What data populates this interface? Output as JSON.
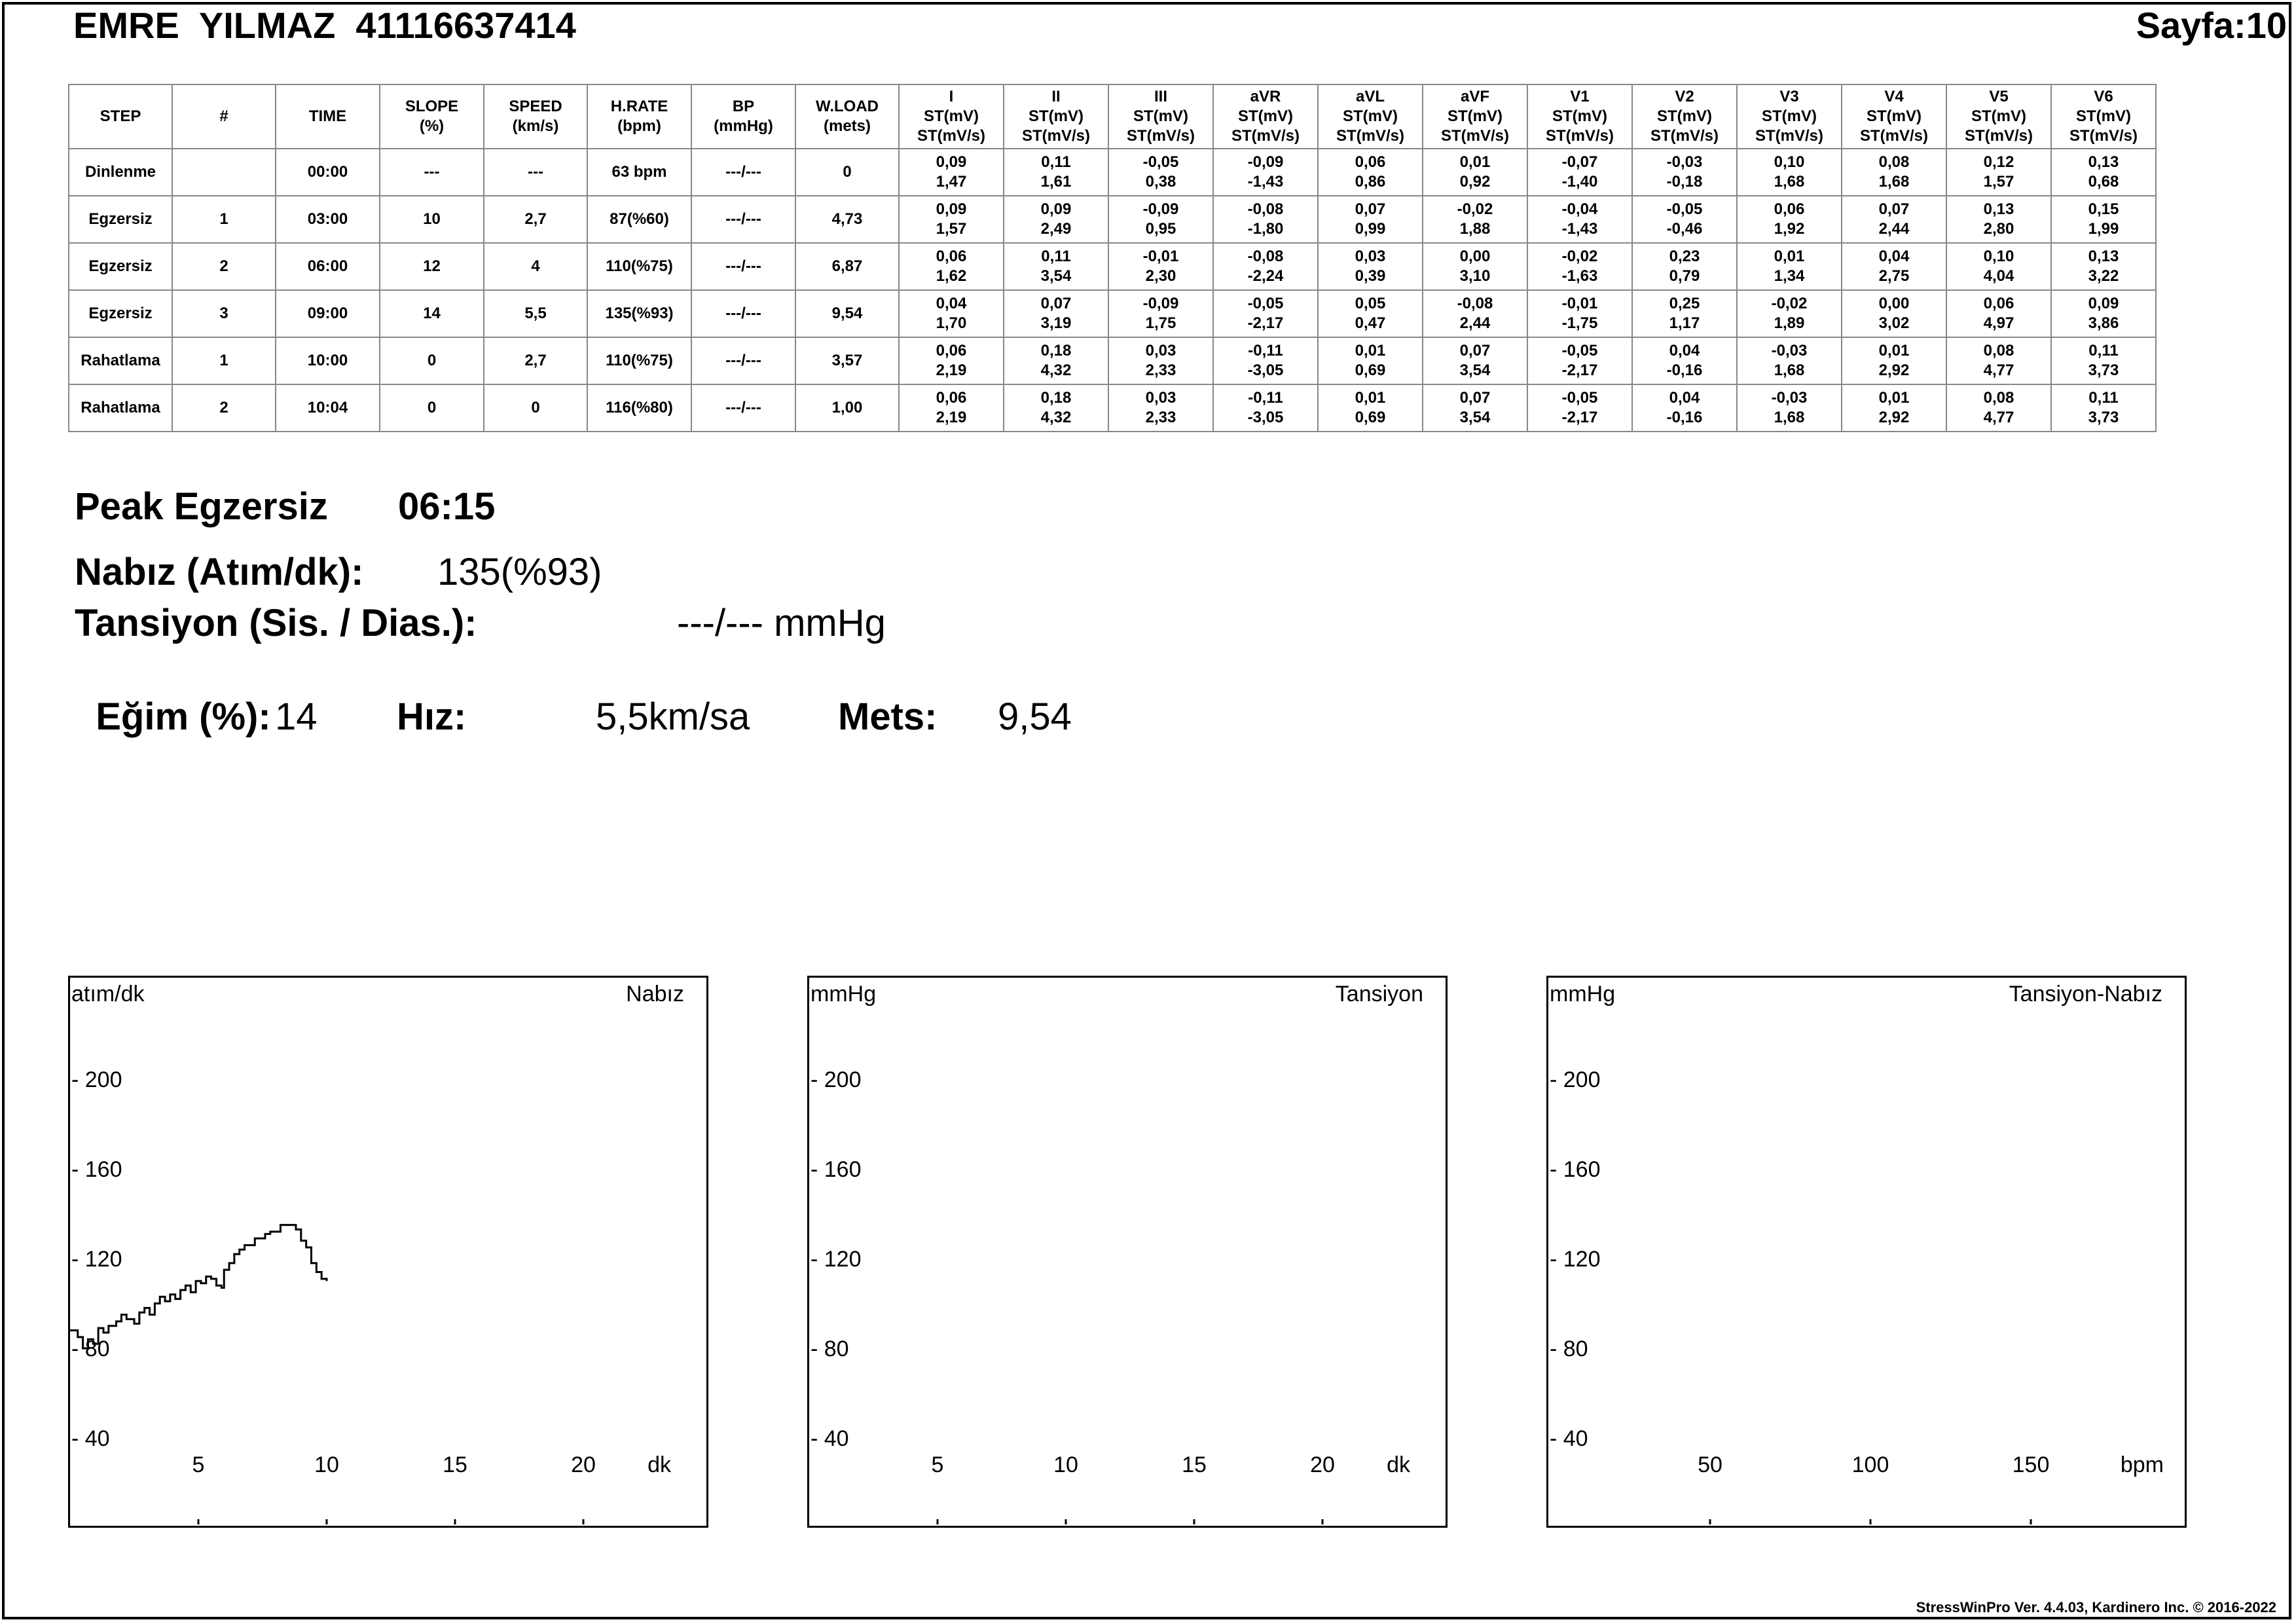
{
  "header": {
    "patient": "EMRE  YILMAZ  41116637414",
    "page": "Sayfa:10"
  },
  "table": {
    "headers": {
      "step": "STEP",
      "num": "#",
      "time": "TIME",
      "slope": [
        "SLOPE",
        "(%)"
      ],
      "speed": [
        "SPEED",
        "(km/s)"
      ],
      "hrate": [
        "H.RATE",
        "(bpm)"
      ],
      "bp": [
        "BP",
        "(mmHg)"
      ],
      "wload": [
        "W.LOAD",
        "(mets)"
      ],
      "st_sub": [
        "ST(mV)",
        "ST(mV/s)"
      ]
    },
    "leads": [
      "I",
      "II",
      "III",
      "aVR",
      "aVL",
      "aVF",
      "V1",
      "V2",
      "V3",
      "V4",
      "V5",
      "V6"
    ],
    "rows": [
      {
        "step": "Dinlenme",
        "num": "",
        "time": "00:00",
        "slope": "---",
        "speed": "---",
        "hrate": "63 bpm",
        "bp": "---/---",
        "wload": "0",
        "st": [
          [
            "0,09",
            "1,47"
          ],
          [
            "0,11",
            "1,61"
          ],
          [
            "-0,05",
            "0,38"
          ],
          [
            "-0,09",
            "-1,43"
          ],
          [
            "0,06",
            "0,86"
          ],
          [
            "0,01",
            "0,92"
          ],
          [
            "-0,07",
            "-1,40"
          ],
          [
            "-0,03",
            "-0,18"
          ],
          [
            "0,10",
            "1,68"
          ],
          [
            "0,08",
            "1,68"
          ],
          [
            "0,12",
            "1,57"
          ],
          [
            "0,13",
            "0,68"
          ]
        ]
      },
      {
        "step": "Egzersiz",
        "num": "1",
        "time": "03:00",
        "slope": "10",
        "speed": "2,7",
        "hrate": "87(%60)",
        "bp": "---/---",
        "wload": "4,73",
        "st": [
          [
            "0,09",
            "1,57"
          ],
          [
            "0,09",
            "2,49"
          ],
          [
            "-0,09",
            "0,95"
          ],
          [
            "-0,08",
            "-1,80"
          ],
          [
            "0,07",
            "0,99"
          ],
          [
            "-0,02",
            "1,88"
          ],
          [
            "-0,04",
            "-1,43"
          ],
          [
            "-0,05",
            "-0,46"
          ],
          [
            "0,06",
            "1,92"
          ],
          [
            "0,07",
            "2,44"
          ],
          [
            "0,13",
            "2,80"
          ],
          [
            "0,15",
            "1,99"
          ]
        ]
      },
      {
        "step": "Egzersiz",
        "num": "2",
        "time": "06:00",
        "slope": "12",
        "speed": "4",
        "hrate": "110(%75)",
        "bp": "---/---",
        "wload": "6,87",
        "st": [
          [
            "0,06",
            "1,62"
          ],
          [
            "0,11",
            "3,54"
          ],
          [
            "-0,01",
            "2,30"
          ],
          [
            "-0,08",
            "-2,24"
          ],
          [
            "0,03",
            "0,39"
          ],
          [
            "0,00",
            "3,10"
          ],
          [
            "-0,02",
            "-1,63"
          ],
          [
            "0,23",
            "0,79"
          ],
          [
            "0,01",
            "1,34"
          ],
          [
            "0,04",
            "2,75"
          ],
          [
            "0,10",
            "4,04"
          ],
          [
            "0,13",
            "3,22"
          ]
        ]
      },
      {
        "step": "Egzersiz",
        "num": "3",
        "time": "09:00",
        "slope": "14",
        "speed": "5,5",
        "hrate": "135(%93)",
        "bp": "---/---",
        "wload": "9,54",
        "st": [
          [
            "0,04",
            "1,70"
          ],
          [
            "0,07",
            "3,19"
          ],
          [
            "-0,09",
            "1,75"
          ],
          [
            "-0,05",
            "-2,17"
          ],
          [
            "0,05",
            "0,47"
          ],
          [
            "-0,08",
            "2,44"
          ],
          [
            "-0,01",
            "-1,75"
          ],
          [
            "0,25",
            "1,17"
          ],
          [
            "-0,02",
            "1,89"
          ],
          [
            "0,00",
            "3,02"
          ],
          [
            "0,06",
            "4,97"
          ],
          [
            "0,09",
            "3,86"
          ]
        ]
      },
      {
        "step": "Rahatlama",
        "num": "1",
        "time": "10:00",
        "slope": "0",
        "speed": "2,7",
        "hrate": "110(%75)",
        "bp": "---/---",
        "wload": "3,57",
        "st": [
          [
            "0,06",
            "2,19"
          ],
          [
            "0,18",
            "4,32"
          ],
          [
            "0,03",
            "2,33"
          ],
          [
            "-0,11",
            "-3,05"
          ],
          [
            "0,01",
            "0,69"
          ],
          [
            "0,07",
            "3,54"
          ],
          [
            "-0,05",
            "-2,17"
          ],
          [
            "0,04",
            "-0,16"
          ],
          [
            "-0,03",
            "1,68"
          ],
          [
            "0,01",
            "2,92"
          ],
          [
            "0,08",
            "4,77"
          ],
          [
            "0,11",
            "3,73"
          ]
        ]
      },
      {
        "step": "Rahatlama",
        "num": "2",
        "time": "10:04",
        "slope": "0",
        "speed": "0",
        "hrate": "116(%80)",
        "bp": "---/---",
        "wload": "1,00",
        "st": [
          [
            "0,06",
            "2,19"
          ],
          [
            "0,18",
            "4,32"
          ],
          [
            "0,03",
            "2,33"
          ],
          [
            "-0,11",
            "-3,05"
          ],
          [
            "0,01",
            "0,69"
          ],
          [
            "0,07",
            "3,54"
          ],
          [
            "-0,05",
            "-2,17"
          ],
          [
            "0,04",
            "-0,16"
          ],
          [
            "-0,03",
            "1,68"
          ],
          [
            "0,01",
            "2,92"
          ],
          [
            "0,08",
            "4,77"
          ],
          [
            "0,11",
            "3,73"
          ]
        ]
      }
    ]
  },
  "summary": {
    "peak_label": "Peak Egzersiz",
    "peak_time": "06:15",
    "pulse_label": "Nabız (Atım/dk):",
    "pulse_value": "135(%93)",
    "bp_label": "Tansiyon (Sis. / Dias.):",
    "bp_value": "---/--- mmHg",
    "slope_label": "Eğim (%):",
    "slope_value": "14",
    "speed_label": "Hız:",
    "speed_value": "5,5km/sa",
    "mets_label": "Mets:",
    "mets_value": "9,54"
  },
  "footer": "StressWinPro Ver. 4.4.03,  Kardinero Inc. © 2016-2022",
  "chart_data": [
    {
      "type": "line",
      "title": "Nabız",
      "ylabel": "atım/dk",
      "xlabel": "dk",
      "ylim": [
        40,
        220
      ],
      "xlim": [
        0,
        25
      ],
      "yticks": [
        200,
        160,
        120,
        80,
        40
      ],
      "xticks": [
        5,
        10,
        15,
        20
      ],
      "series": [
        {
          "x": [
            0,
            0.3,
            0.5,
            0.7,
            0.9,
            1.1,
            1.3,
            1.5,
            1.8,
            2.0,
            2.2,
            2.5,
            2.7,
            2.9,
            3.1,
            3.3,
            3.5,
            3.7,
            3.9,
            4.1,
            4.3,
            4.5,
            4.7,
            4.9,
            5.1,
            5.3,
            5.5,
            5.7,
            5.9,
            6.0,
            6.2,
            6.4,
            6.6,
            6.8,
            7.0,
            7.2,
            7.4,
            7.6,
            7.8,
            8.0,
            8.2,
            8.4,
            8.6,
            8.8,
            9.0,
            9.2,
            9.4,
            9.6,
            9.8,
            10.0
          ],
          "y": [
            88,
            85,
            80,
            84,
            82,
            89,
            87,
            90,
            92,
            95,
            93,
            91,
            96,
            98,
            95,
            100,
            103,
            101,
            104,
            102,
            106,
            108,
            105,
            110,
            109,
            112,
            111,
            108,
            107,
            115,
            118,
            122,
            124,
            126,
            126,
            129,
            129,
            131,
            132,
            132,
            135,
            135,
            135,
            133,
            128,
            125,
            118,
            114,
            111,
            110
          ]
        }
      ]
    },
    {
      "type": "line",
      "title": "Tansiyon",
      "ylabel": "mmHg",
      "xlabel": "dk",
      "ylim": [
        40,
        220
      ],
      "xlim": [
        0,
        25
      ],
      "yticks": [
        200,
        160,
        120,
        80,
        40
      ],
      "xticks": [
        5,
        10,
        15,
        20
      ],
      "series": []
    },
    {
      "type": "scatter",
      "title": "Tansiyon-Nabız",
      "ylabel": "mmHg",
      "xlabel": "bpm",
      "ylim": [
        40,
        220
      ],
      "xlim": [
        0,
        200
      ],
      "yticks": [
        200,
        160,
        120,
        80,
        40
      ],
      "xticks": [
        50,
        100,
        150
      ],
      "series": []
    }
  ]
}
